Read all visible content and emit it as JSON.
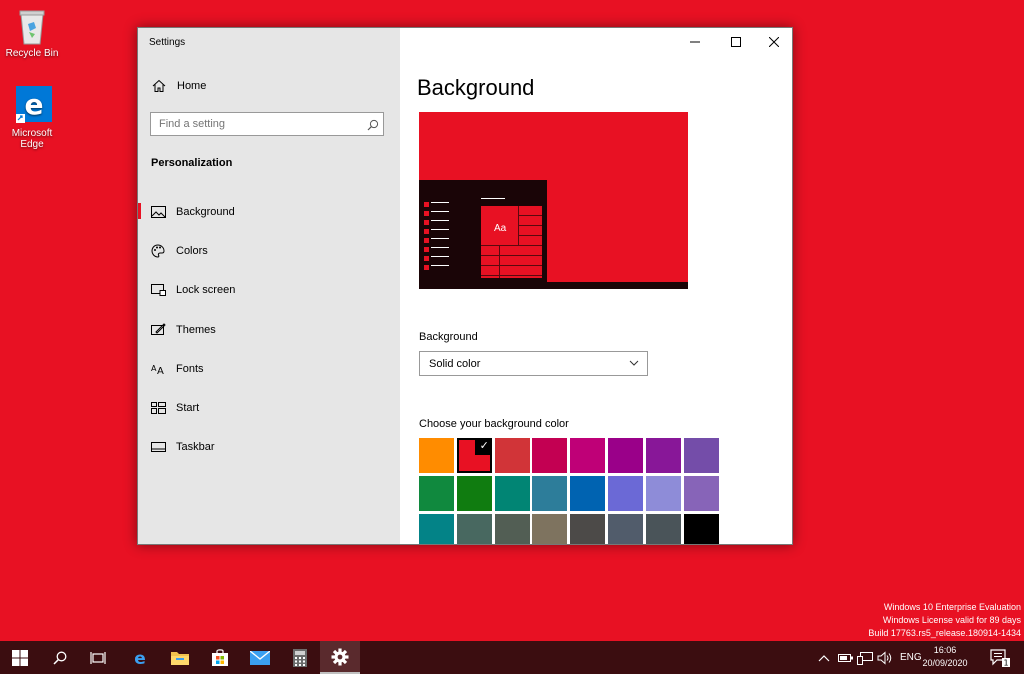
{
  "desktop": {
    "icons": [
      {
        "label": "Recycle Bin"
      },
      {
        "label_line1": "Microsoft",
        "label_line2": "Edge"
      }
    ]
  },
  "window": {
    "title": "Settings",
    "sidebar": {
      "home_label": "Home",
      "search_placeholder": "Find a setting",
      "section_title": "Personalization",
      "items": [
        {
          "label": "Background",
          "icon": "picture-icon",
          "active": true
        },
        {
          "label": "Colors",
          "icon": "palette-icon"
        },
        {
          "label": "Lock screen",
          "icon": "lock-screen-icon"
        },
        {
          "label": "Themes",
          "icon": "themes-icon"
        },
        {
          "label": "Fonts",
          "icon": "fonts-icon"
        },
        {
          "label": "Start",
          "icon": "start-icon"
        },
        {
          "label": "Taskbar",
          "icon": "taskbar-icon"
        }
      ]
    },
    "content": {
      "page_title": "Background",
      "preview_sample_text": "Aa",
      "background_label": "Background",
      "background_value": "Solid color",
      "choose_color_label": "Choose your background color",
      "selected_color": "#e81123",
      "swatch_rows": [
        [
          "#ff8c00",
          "#e81123",
          "#d13438",
          "#c30052",
          "#bf0077",
          "#9a0089",
          "#881798",
          "#744da9"
        ],
        [
          "#10893e",
          "#107c10",
          "#018574",
          "#2d7d9a",
          "#0063b1",
          "#6b69d6",
          "#8e8cd8",
          "#8764b8"
        ],
        [
          "#038387",
          "#486860",
          "#525e54",
          "#7e735f",
          "#4c4a48",
          "#515c6b",
          "#4a5459",
          "#000000"
        ]
      ]
    }
  },
  "watermark": {
    "line1": "Windows 10 Enterprise Evaluation",
    "line2": "Windows License valid for 89 days",
    "line3": "Build 17763.rs5_release.180914-1434"
  },
  "taskbar": {
    "language": "ENG",
    "time": "16:06",
    "date": "20/09/2020",
    "notification_count": "1"
  }
}
